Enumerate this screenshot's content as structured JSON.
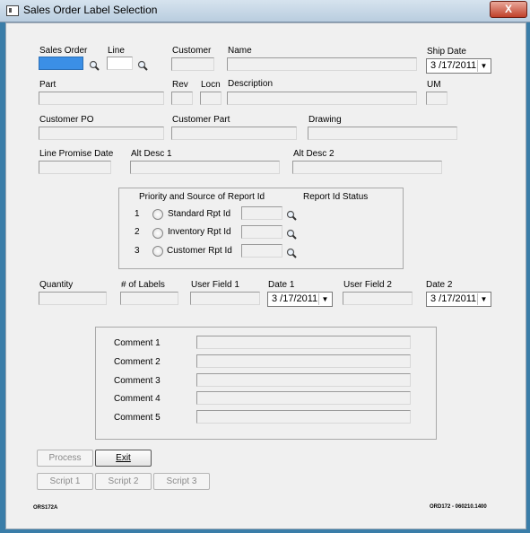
{
  "window": {
    "title": "Sales Order Label Selection",
    "close_label": "X"
  },
  "labels": {
    "sales_order": "Sales Order",
    "line": "Line",
    "customer": "Customer",
    "name": "Name",
    "ship_date": "Ship Date",
    "part": "Part",
    "rev": "Rev",
    "locn": "Locn",
    "description": "Description",
    "um": "UM",
    "customer_po": "Customer PO",
    "customer_part": "Customer Part",
    "drawing": "Drawing",
    "line_promise_date": "Line Promise Date",
    "alt_desc_1": "Alt Desc 1",
    "alt_desc_2": "Alt Desc 2",
    "quantity": "Quantity",
    "num_labels": "# of Labels",
    "user_field_1": "User Field 1",
    "date_1": "Date 1",
    "user_field_2": "User Field 2",
    "date_2": "Date 2"
  },
  "values": {
    "ship_date": "3 /17/2011",
    "date_1": "3 /17/2011",
    "date_2": "3 /17/2011"
  },
  "report": {
    "header_priority": "Priority and Source of Report Id",
    "header_status": "Report Id Status",
    "options": [
      {
        "num": "1",
        "label": "Standard Rpt Id"
      },
      {
        "num": "2",
        "label": "Inventory Rpt Id"
      },
      {
        "num": "3",
        "label": "Customer Rpt Id"
      }
    ]
  },
  "comments": [
    "Comment 1",
    "Comment 2",
    "Comment 3",
    "Comment 4",
    "Comment 5"
  ],
  "buttons": {
    "process": "Process",
    "exit": "Exit",
    "script1": "Script 1",
    "script2": "Script 2",
    "script3": "Script 3"
  },
  "footer": {
    "left": "ORS172A",
    "right": "ORD172 - 060210.1400"
  },
  "icons": {
    "lookup": "magnifier-icon",
    "dropdown": "chevron-down-icon"
  }
}
